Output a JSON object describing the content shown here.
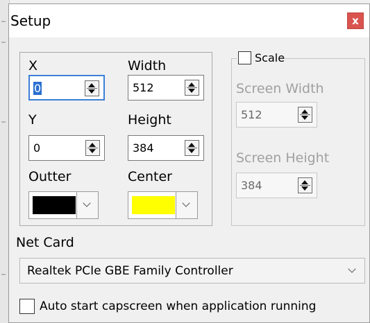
{
  "window": {
    "title": "Setup",
    "close_glyph": "x"
  },
  "fields": {
    "x": {
      "label": "X",
      "value": "0"
    },
    "width": {
      "label": "Width",
      "value": "512"
    },
    "y": {
      "label": "Y",
      "value": "0"
    },
    "height": {
      "label": "Height",
      "value": "384"
    }
  },
  "colors": {
    "outter": {
      "label": "Outter",
      "value": "#000000"
    },
    "center": {
      "label": "Center",
      "value": "#ffff00"
    }
  },
  "scale": {
    "label": "Scale",
    "checked": false,
    "screen_width": {
      "label": "Screen Width",
      "value": "512"
    },
    "screen_height": {
      "label": "Screen Height",
      "value": "384"
    }
  },
  "net_card": {
    "label": "Net Card",
    "selected": "Realtek PCIe GBE Family Controller"
  },
  "autostart": {
    "label": "Auto start capscreen when application running",
    "checked": false
  },
  "icons": [
    "close-icon",
    "spin-up-icon",
    "spin-down-icon",
    "chevron-down-icon"
  ]
}
